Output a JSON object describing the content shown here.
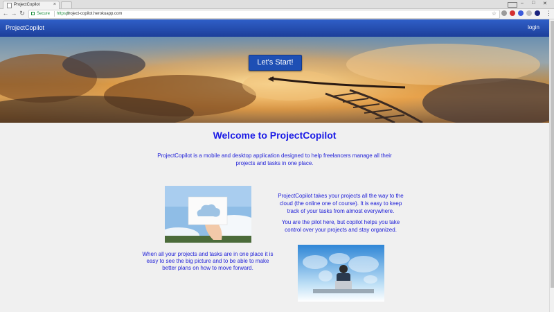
{
  "browser": {
    "tab_title": "ProjectCopilot",
    "tab_close": "×",
    "secure_label": "Secure",
    "url_scheme": "https://",
    "url_host": "project-copilot.herokuapp.com",
    "back_icon": "←",
    "forward_icon": "→",
    "reload_icon": "↻",
    "star_icon": "☆",
    "menu_icon": "⋮",
    "min_icon": "–",
    "max_icon": "□",
    "close_icon": "✕"
  },
  "navbar": {
    "brand": "ProjectCopilot",
    "login": "login"
  },
  "hero": {
    "cta_label": "Let's Start!"
  },
  "main": {
    "welcome_title": "Welcome to ProjectCopilot",
    "intro": "ProjectCopilot is a mobile and desktop application designed to help freelancers manage all their projects and tasks in one place.",
    "right_text_1": "ProjectCopilot takes your projects all the way to the cloud (the online one of course). It is easy to keep track of your tasks from almost everywhere.",
    "right_text_2": "You are the pilot here, but copilot helps you take control over your projects and stay organized.",
    "left_text": "When all your projects and tasks are in one place it is easy to see the big picture and to be able to make better plans on how to move forward."
  },
  "colors": {
    "accent": "#1a1ae6",
    "navbar": "#2a56be",
    "secure": "#1e8e3e"
  }
}
